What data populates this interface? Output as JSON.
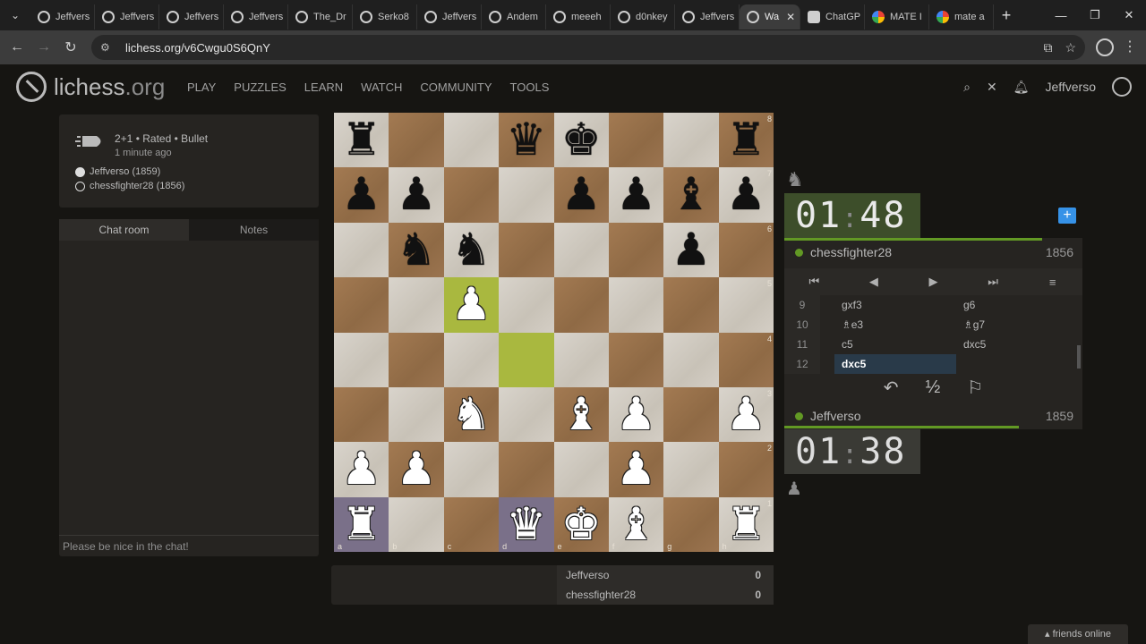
{
  "browser": {
    "tabs": [
      {
        "label": "Jeffvers",
        "icon": "lichess"
      },
      {
        "label": "Jeffvers",
        "icon": "lichess"
      },
      {
        "label": "Jeffvers",
        "icon": "lichess"
      },
      {
        "label": "Jeffvers",
        "icon": "lichess"
      },
      {
        "label": "The_Dr",
        "icon": "lichess"
      },
      {
        "label": "Serko8",
        "icon": "lichess"
      },
      {
        "label": "Jeffvers",
        "icon": "lichess"
      },
      {
        "label": "Andem",
        "icon": "lichess"
      },
      {
        "label": "meeeh",
        "icon": "lichess"
      },
      {
        "label": "d0nkey",
        "icon": "lichess"
      },
      {
        "label": "Jeffvers",
        "icon": "lichess"
      },
      {
        "label": "Wa",
        "icon": "lichess",
        "active": true
      },
      {
        "label": "ChatGP",
        "icon": "chatgpt"
      },
      {
        "label": "MATE I",
        "icon": "google"
      },
      {
        "label": "mate a",
        "icon": "google"
      }
    ],
    "url": "lichess.org/v6Cwgu0S6QnY"
  },
  "site": {
    "logo": "lichess",
    "logo_tld": ".org",
    "nav": [
      "PLAY",
      "PUZZLES",
      "LEARN",
      "WATCH",
      "COMMUNITY",
      "TOOLS"
    ],
    "username": "Jeffverso"
  },
  "game": {
    "type_line": "2+1 • Rated • Bullet",
    "time_ago": "1 minute ago",
    "white_player": "Jeffverso (1859)",
    "black_player": "chessfighter28 (1856)"
  },
  "chat": {
    "tab_chat": "Chat room",
    "tab_notes": "Notes",
    "placeholder": "Please be nice in the chat!"
  },
  "board": {
    "files": [
      "a",
      "b",
      "c",
      "d",
      "e",
      "f",
      "g",
      "h"
    ],
    "ranks": [
      "8",
      "7",
      "6",
      "5",
      "4",
      "3",
      "2",
      "1"
    ],
    "pieces": [
      {
        "sq": "a8",
        "p": "♜",
        "c": "b"
      },
      {
        "sq": "d8",
        "p": "♛",
        "c": "b"
      },
      {
        "sq": "e8",
        "p": "♚",
        "c": "b"
      },
      {
        "sq": "h8",
        "p": "♜",
        "c": "b"
      },
      {
        "sq": "a7",
        "p": "♟",
        "c": "b"
      },
      {
        "sq": "b7",
        "p": "♟",
        "c": "b"
      },
      {
        "sq": "e7",
        "p": "♟",
        "c": "b"
      },
      {
        "sq": "f7",
        "p": "♟",
        "c": "b"
      },
      {
        "sq": "g7",
        "p": "♝",
        "c": "b"
      },
      {
        "sq": "h7",
        "p": "♟",
        "c": "b"
      },
      {
        "sq": "b6",
        "p": "♞",
        "c": "b"
      },
      {
        "sq": "c6",
        "p": "♞",
        "c": "b"
      },
      {
        "sq": "g6",
        "p": "♟",
        "c": "b"
      },
      {
        "sq": "c5",
        "p": "♟",
        "c": "w"
      },
      {
        "sq": "c3",
        "p": "♞",
        "c": "w"
      },
      {
        "sq": "e3",
        "p": "♝",
        "c": "w"
      },
      {
        "sq": "f3",
        "p": "♟",
        "c": "w"
      },
      {
        "sq": "h3",
        "p": "♟",
        "c": "w"
      },
      {
        "sq": "a2",
        "p": "♟",
        "c": "w"
      },
      {
        "sq": "b2",
        "p": "♟",
        "c": "w"
      },
      {
        "sq": "f2",
        "p": "♟",
        "c": "w"
      },
      {
        "sq": "a1",
        "p": "♜",
        "c": "w"
      },
      {
        "sq": "d1",
        "p": "♛",
        "c": "w"
      },
      {
        "sq": "e1",
        "p": "♚",
        "c": "w"
      },
      {
        "sq": "f1",
        "p": "♝",
        "c": "w"
      },
      {
        "sq": "h1",
        "p": "♜",
        "c": "w"
      }
    ],
    "last_move": [
      "c5",
      "d4"
    ],
    "selected": [
      "a1",
      "d1"
    ]
  },
  "clocks": {
    "top_min": "01",
    "top_sec": "48",
    "bottom_min": "01",
    "bottom_sec": "38"
  },
  "opponent": {
    "name": "chessfighter28",
    "rating": "1856"
  },
  "me": {
    "name": "Jeffverso",
    "rating": "1859"
  },
  "moves": [
    {
      "n": "9",
      "w": "gxf3",
      "b": "g6"
    },
    {
      "n": "10",
      "w": "♗e3",
      "b": "♗g7"
    },
    {
      "n": "11",
      "w": "c5",
      "b": "dxc5"
    },
    {
      "n": "12",
      "w": "dxc5",
      "b": ""
    }
  ],
  "controls": [
    "⏮",
    "◀",
    "▶",
    "⏭",
    "≡"
  ],
  "actions": [
    "↶",
    "½",
    "⚐"
  ],
  "crosstable": [
    {
      "name": "Jeffverso",
      "score": "0"
    },
    {
      "name": "chessfighter28",
      "score": "0"
    }
  ],
  "footer": {
    "friends": "friends online"
  },
  "colors": {
    "accent_green": "#629924",
    "highlight": "#a9b83f",
    "bg": "#161512"
  }
}
